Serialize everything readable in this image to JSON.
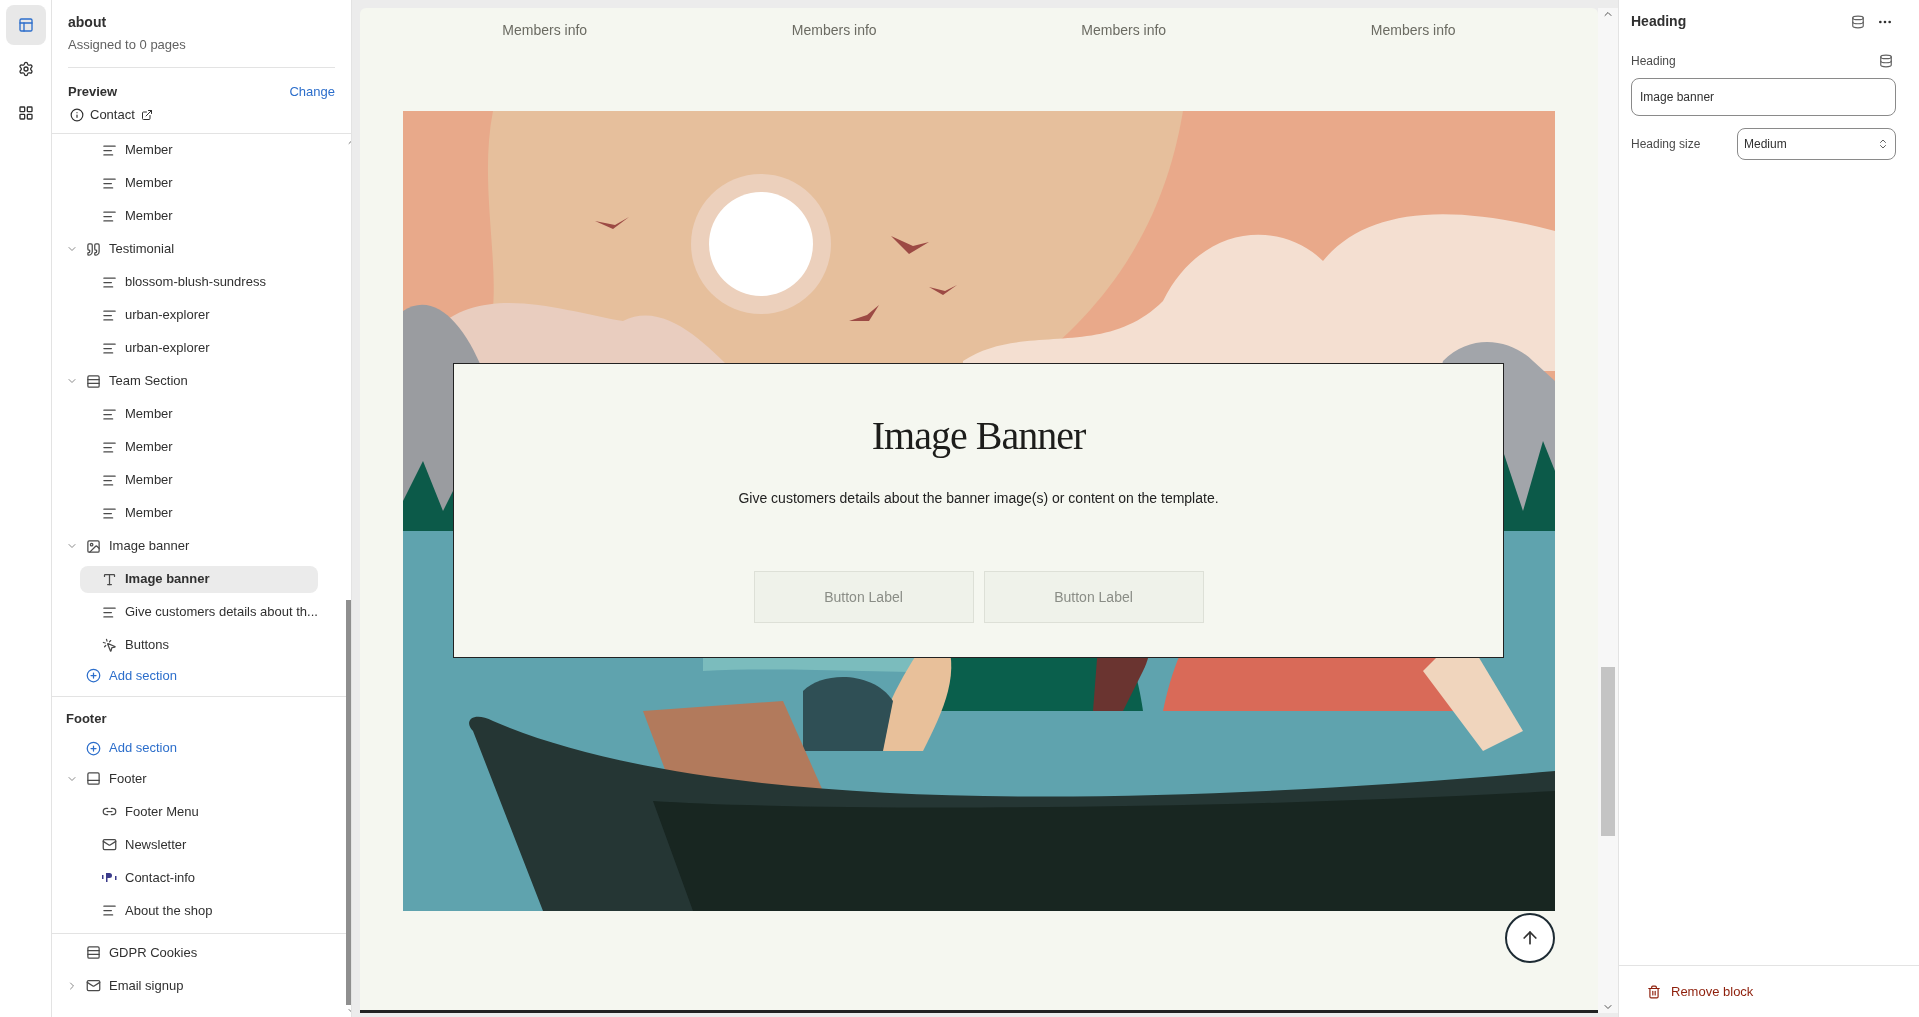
{
  "rail": [
    {
      "kind": "sections",
      "selected": true
    },
    {
      "kind": "settings",
      "selected": false
    },
    {
      "kind": "apps",
      "selected": false
    }
  ],
  "template": {
    "name": "about",
    "assigned": "Assigned to 0 pages"
  },
  "preview": {
    "label": "Preview",
    "change": "Change",
    "page": "Contact"
  },
  "groups": [
    {
      "kind": "template",
      "add_label": "Add section",
      "sections": [
        {
          "children": [
            {
              "label": "Member",
              "kind": "text",
              "selected": false
            },
            {
              "label": "Member",
              "kind": "text",
              "selected": false
            },
            {
              "label": "Member",
              "kind": "text",
              "selected": false
            }
          ]
        },
        {
          "label": "Testimonial",
          "kind": "testimonial",
          "expanded": true,
          "children": [
            {
              "label": "blossom-blush-sundress",
              "kind": "text",
              "selected": false
            },
            {
              "label": "urban-explorer",
              "kind": "text",
              "selected": false
            },
            {
              "label": "urban-explorer",
              "kind": "text",
              "selected": false
            }
          ]
        },
        {
          "label": "Team Section",
          "kind": "section",
          "expanded": true,
          "children": [
            {
              "label": "Member",
              "kind": "text",
              "selected": false
            },
            {
              "label": "Member",
              "kind": "text",
              "selected": false
            },
            {
              "label": "Member",
              "kind": "text",
              "selected": false
            },
            {
              "label": "Member",
              "kind": "text",
              "selected": false
            }
          ]
        },
        {
          "label": "Image banner",
          "kind": "image",
          "expanded": true,
          "children": [
            {
              "label": "Image banner",
              "kind": "heading",
              "selected": true
            },
            {
              "label": "Give customers details about th...",
              "kind": "text",
              "selected": false
            },
            {
              "label": "Buttons",
              "kind": "buttons",
              "selected": false
            }
          ]
        }
      ]
    },
    {
      "kind": "footer",
      "title": "Footer",
      "add_label": "Add section",
      "sections": [
        {
          "label": "Footer",
          "kind": "footer",
          "expanded": true,
          "children": [
            {
              "label": "Footer Menu",
              "kind": "link",
              "selected": false
            },
            {
              "label": "Newsletter",
              "kind": "email",
              "selected": false
            },
            {
              "label": "Contact-info",
              "kind": "contact",
              "selected": false
            },
            {
              "label": "About the shop",
              "kind": "text",
              "selected": false
            }
          ]
        }
      ]
    },
    {
      "kind": "overlay",
      "sections": [
        {
          "label": "GDPR Cookies",
          "kind": "section"
        },
        {
          "label": "Email signup",
          "kind": "email",
          "expanded": false
        }
      ]
    }
  ],
  "canvas": {
    "tabs": [
      "Members info",
      "Members info",
      "Members info",
      "Members info"
    ],
    "banner": {
      "heading": "Image Banner",
      "text": "Give customers details about the banner image(s) or content on the template.",
      "buttons": [
        "Button Label",
        "Button Label"
      ]
    }
  },
  "inspector": {
    "title": "Heading",
    "field_label": "Heading",
    "field_value": "Image banner",
    "size_label": "Heading size",
    "size_value": "Medium",
    "remove": "Remove block"
  }
}
